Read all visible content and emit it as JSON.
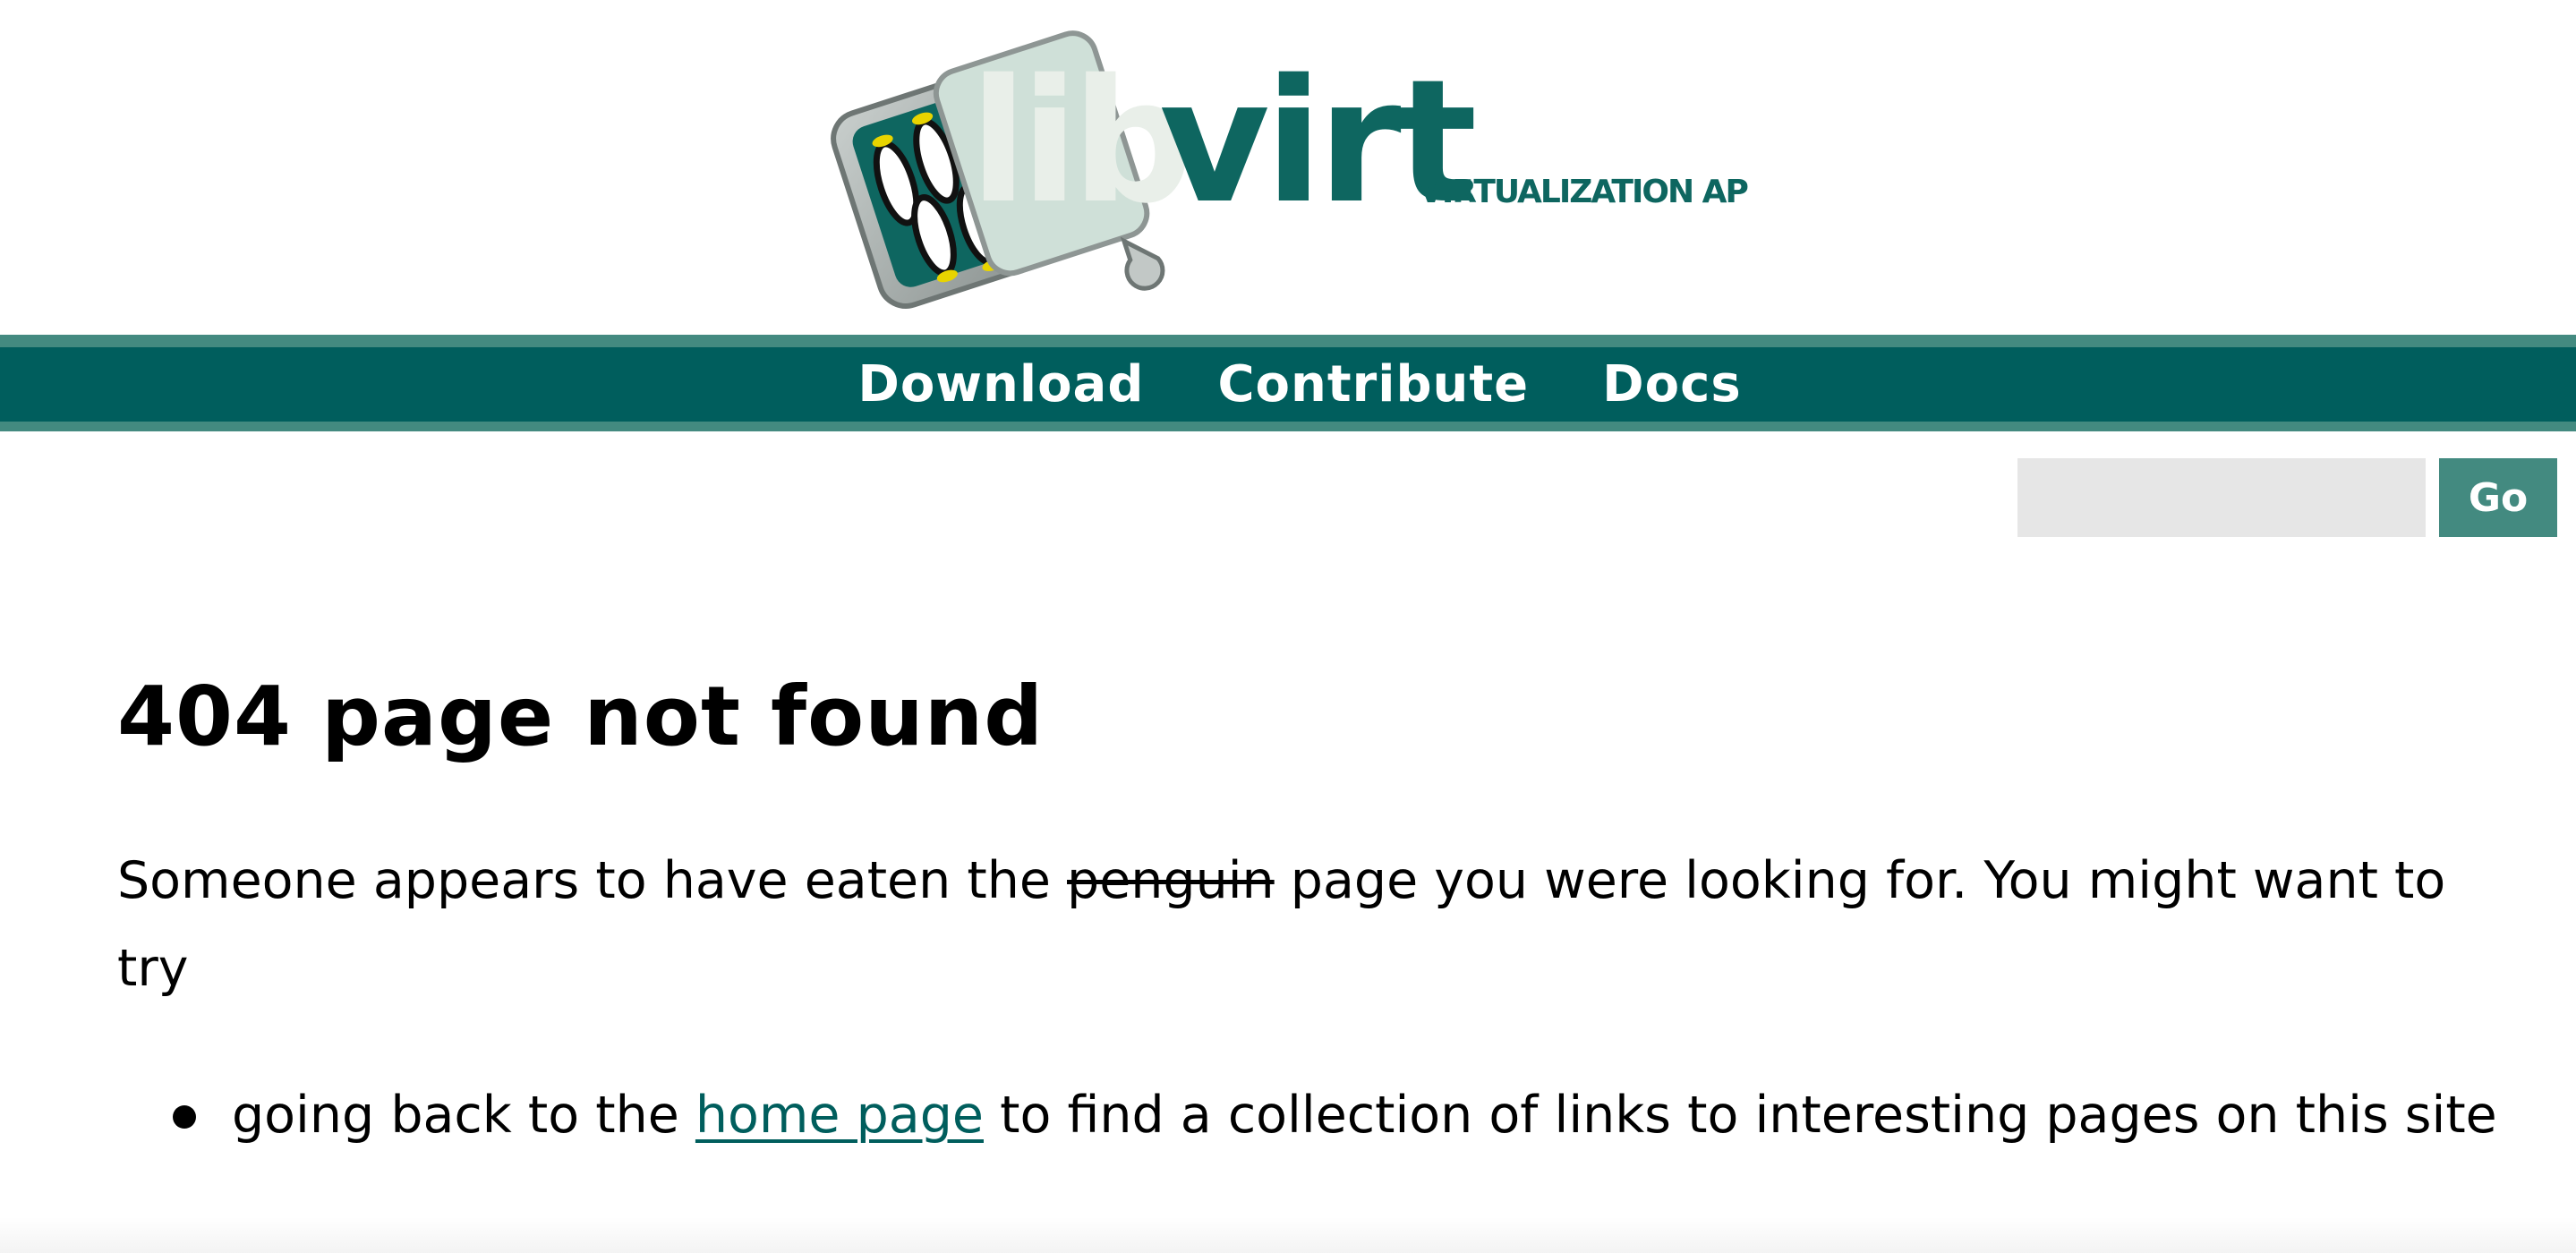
{
  "header": {
    "logo": {
      "wordmark_part1": "lib",
      "wordmark_part2": "virt",
      "tagline": "VIRTUALIZATION API",
      "colors": {
        "teal": "#0e6660",
        "light_green": "#cfe0d8",
        "case_gray": "#a9b0ae"
      }
    }
  },
  "nav": {
    "items": [
      {
        "label": "Download"
      },
      {
        "label": "Contribute"
      },
      {
        "label": "Docs"
      }
    ],
    "background": "#005e5d",
    "border_color": "#438a80"
  },
  "search": {
    "value": "",
    "placeholder": "",
    "button_label": "Go"
  },
  "main": {
    "title": "404 page not found",
    "intro": {
      "before": "Someone appears to have eaten the ",
      "struck": "penguin",
      "after": " page you were looking for. You might want to try"
    },
    "options": [
      {
        "before": "going back to the ",
        "link": "home page",
        "after": " to find a collection of links to interesting pages on this site"
      }
    ],
    "link_color": "#005e5d"
  }
}
